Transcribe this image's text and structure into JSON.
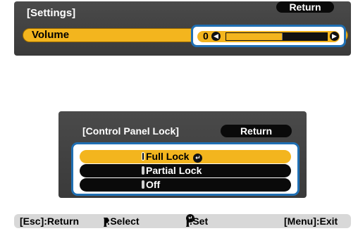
{
  "settings_panel": {
    "title": "[Settings]",
    "return_label": "Return",
    "volume": {
      "label": "Volume",
      "value": "0",
      "level_fraction": 0.56,
      "left_arrow_icon": "left-arrow-circle-icon",
      "right_arrow_icon": "right-arrow-circle-icon"
    }
  },
  "lock_dialog": {
    "title": "[Control Panel Lock]",
    "return_label": "Return",
    "options": [
      {
        "label": "Full Lock",
        "selected": true
      },
      {
        "label": "Partial Lock",
        "selected": false
      },
      {
        "label": "Off",
        "selected": false
      }
    ],
    "set_icon": "enter-circle-icon"
  },
  "help_bar": {
    "esc": "[Esc]:Return",
    "select_pre": "[",
    "select_post": "]:Select",
    "set_pre": "[",
    "set_post": "]:Set",
    "menu": "[Menu]:Exit",
    "updown_icon": "updown-arrows-icon",
    "enter_icon": "enter-circle-icon"
  },
  "colors": {
    "panel_bg": "#404040",
    "highlight": "#f3b51e",
    "focus_frame": "#1f6fb3",
    "help_bg": "#d8d8d8"
  }
}
